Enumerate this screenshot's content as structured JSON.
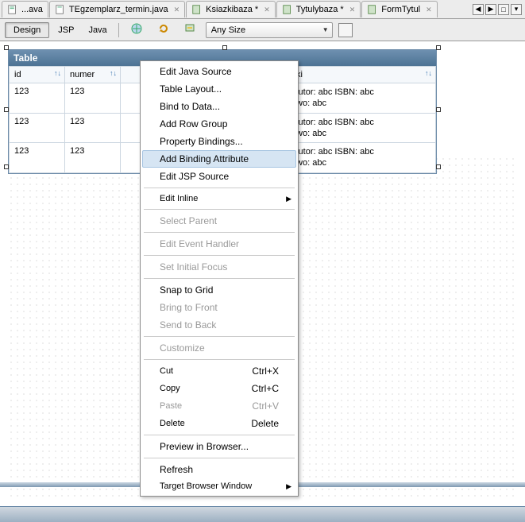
{
  "tabs": [
    {
      "label": "...ava",
      "closable": false
    },
    {
      "label": "TEgzemplarz_termin.java",
      "closable": true
    },
    {
      "label": "Ksiazkibaza *",
      "closable": true
    },
    {
      "label": "Tytulybaza *",
      "closable": true
    },
    {
      "label": "FormTytul",
      "closable": true
    }
  ],
  "toolbar": {
    "design": "Design",
    "jsp": "JSP",
    "java": "Java",
    "size_label": "Any Size"
  },
  "table": {
    "title": "Table",
    "columns": [
      {
        "header": "id"
      },
      {
        "header": "numer"
      },
      {
        "header": ""
      },
      {
        "header": "ksiazki"
      }
    ],
    "rows": [
      {
        "id": "123",
        "numer": "123",
        "c3": "",
        "ksiazki": "abc Autor: abc ISBN: abc\nwnictwo: abc"
      },
      {
        "id": "123",
        "numer": "123",
        "c3": "",
        "ksiazki": "abc Autor: abc ISBN: abc\nwnictwo: abc"
      },
      {
        "id": "123",
        "numer": "123",
        "c3": "",
        "ksiazki": "abc Autor: abc ISBN: abc\nwnictwo: abc"
      }
    ]
  },
  "menu": {
    "edit_java": "Edit Java Source",
    "table_layout": "Table Layout...",
    "bind_data": "Bind to Data...",
    "add_row_group": "Add Row Group",
    "prop_bindings": "Property Bindings...",
    "add_binding_attr": "Add Binding Attribute",
    "edit_jsp": "Edit JSP Source",
    "edit_inline": "Edit Inline",
    "select_parent": "Select Parent",
    "edit_event": "Edit Event Handler",
    "set_focus": "Set Initial Focus",
    "snap_grid": "Snap to Grid",
    "bring_front": "Bring to Front",
    "send_back": "Send to Back",
    "customize": "Customize",
    "cut": "Cut",
    "copy": "Copy",
    "paste": "Paste",
    "delete": "Delete",
    "preview": "Preview in Browser...",
    "refresh": "Refresh",
    "target_browser": "Target Browser Window",
    "sc_cut": "Ctrl+X",
    "sc_copy": "Ctrl+C",
    "sc_paste": "Ctrl+V",
    "sc_delete": "Delete"
  }
}
